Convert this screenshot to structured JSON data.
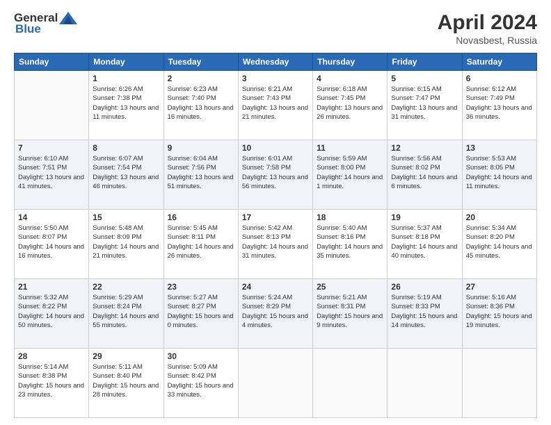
{
  "logo": {
    "general": "General",
    "blue": "Blue"
  },
  "title": "April 2024",
  "location": "Novasbest, Russia",
  "days_header": [
    "Sunday",
    "Monday",
    "Tuesday",
    "Wednesday",
    "Thursday",
    "Friday",
    "Saturday"
  ],
  "weeks": [
    [
      {
        "day": "",
        "sunrise": "",
        "sunset": "",
        "daylight": ""
      },
      {
        "day": "1",
        "sunrise": "Sunrise: 6:26 AM",
        "sunset": "Sunset: 7:38 PM",
        "daylight": "Daylight: 13 hours and 11 minutes."
      },
      {
        "day": "2",
        "sunrise": "Sunrise: 6:23 AM",
        "sunset": "Sunset: 7:40 PM",
        "daylight": "Daylight: 13 hours and 16 minutes."
      },
      {
        "day": "3",
        "sunrise": "Sunrise: 6:21 AM",
        "sunset": "Sunset: 7:43 PM",
        "daylight": "Daylight: 13 hours and 21 minutes."
      },
      {
        "day": "4",
        "sunrise": "Sunrise: 6:18 AM",
        "sunset": "Sunset: 7:45 PM",
        "daylight": "Daylight: 13 hours and 26 minutes."
      },
      {
        "day": "5",
        "sunrise": "Sunrise: 6:15 AM",
        "sunset": "Sunset: 7:47 PM",
        "daylight": "Daylight: 13 hours and 31 minutes."
      },
      {
        "day": "6",
        "sunrise": "Sunrise: 6:12 AM",
        "sunset": "Sunset: 7:49 PM",
        "daylight": "Daylight: 13 hours and 36 minutes."
      }
    ],
    [
      {
        "day": "7",
        "sunrise": "Sunrise: 6:10 AM",
        "sunset": "Sunset: 7:51 PM",
        "daylight": "Daylight: 13 hours and 41 minutes."
      },
      {
        "day": "8",
        "sunrise": "Sunrise: 6:07 AM",
        "sunset": "Sunset: 7:54 PM",
        "daylight": "Daylight: 13 hours and 46 minutes."
      },
      {
        "day": "9",
        "sunrise": "Sunrise: 6:04 AM",
        "sunset": "Sunset: 7:56 PM",
        "daylight": "Daylight: 13 hours and 51 minutes."
      },
      {
        "day": "10",
        "sunrise": "Sunrise: 6:01 AM",
        "sunset": "Sunset: 7:58 PM",
        "daylight": "Daylight: 13 hours and 56 minutes."
      },
      {
        "day": "11",
        "sunrise": "Sunrise: 5:59 AM",
        "sunset": "Sunset: 8:00 PM",
        "daylight": "Daylight: 14 hours and 1 minute."
      },
      {
        "day": "12",
        "sunrise": "Sunrise: 5:56 AM",
        "sunset": "Sunset: 8:02 PM",
        "daylight": "Daylight: 14 hours and 6 minutes."
      },
      {
        "day": "13",
        "sunrise": "Sunrise: 5:53 AM",
        "sunset": "Sunset: 8:05 PM",
        "daylight": "Daylight: 14 hours and 11 minutes."
      }
    ],
    [
      {
        "day": "14",
        "sunrise": "Sunrise: 5:50 AM",
        "sunset": "Sunset: 8:07 PM",
        "daylight": "Daylight: 14 hours and 16 minutes."
      },
      {
        "day": "15",
        "sunrise": "Sunrise: 5:48 AM",
        "sunset": "Sunset: 8:09 PM",
        "daylight": "Daylight: 14 hours and 21 minutes."
      },
      {
        "day": "16",
        "sunrise": "Sunrise: 5:45 AM",
        "sunset": "Sunset: 8:11 PM",
        "daylight": "Daylight: 14 hours and 26 minutes."
      },
      {
        "day": "17",
        "sunrise": "Sunrise: 5:42 AM",
        "sunset": "Sunset: 8:13 PM",
        "daylight": "Daylight: 14 hours and 31 minutes."
      },
      {
        "day": "18",
        "sunrise": "Sunrise: 5:40 AM",
        "sunset": "Sunset: 8:16 PM",
        "daylight": "Daylight: 14 hours and 35 minutes."
      },
      {
        "day": "19",
        "sunrise": "Sunrise: 5:37 AM",
        "sunset": "Sunset: 8:18 PM",
        "daylight": "Daylight: 14 hours and 40 minutes."
      },
      {
        "day": "20",
        "sunrise": "Sunrise: 5:34 AM",
        "sunset": "Sunset: 8:20 PM",
        "daylight": "Daylight: 14 hours and 45 minutes."
      }
    ],
    [
      {
        "day": "21",
        "sunrise": "Sunrise: 5:32 AM",
        "sunset": "Sunset: 8:22 PM",
        "daylight": "Daylight: 14 hours and 50 minutes."
      },
      {
        "day": "22",
        "sunrise": "Sunrise: 5:29 AM",
        "sunset": "Sunset: 8:24 PM",
        "daylight": "Daylight: 14 hours and 55 minutes."
      },
      {
        "day": "23",
        "sunrise": "Sunrise: 5:27 AM",
        "sunset": "Sunset: 8:27 PM",
        "daylight": "Daylight: 15 hours and 0 minutes."
      },
      {
        "day": "24",
        "sunrise": "Sunrise: 5:24 AM",
        "sunset": "Sunset: 8:29 PM",
        "daylight": "Daylight: 15 hours and 4 minutes."
      },
      {
        "day": "25",
        "sunrise": "Sunrise: 5:21 AM",
        "sunset": "Sunset: 8:31 PM",
        "daylight": "Daylight: 15 hours and 9 minutes."
      },
      {
        "day": "26",
        "sunrise": "Sunrise: 5:19 AM",
        "sunset": "Sunset: 8:33 PM",
        "daylight": "Daylight: 15 hours and 14 minutes."
      },
      {
        "day": "27",
        "sunrise": "Sunrise: 5:16 AM",
        "sunset": "Sunset: 8:36 PM",
        "daylight": "Daylight: 15 hours and 19 minutes."
      }
    ],
    [
      {
        "day": "28",
        "sunrise": "Sunrise: 5:14 AM",
        "sunset": "Sunset: 8:38 PM",
        "daylight": "Daylight: 15 hours and 23 minutes."
      },
      {
        "day": "29",
        "sunrise": "Sunrise: 5:11 AM",
        "sunset": "Sunset: 8:40 PM",
        "daylight": "Daylight: 15 hours and 28 minutes."
      },
      {
        "day": "30",
        "sunrise": "Sunrise: 5:09 AM",
        "sunset": "Sunset: 8:42 PM",
        "daylight": "Daylight: 15 hours and 33 minutes."
      },
      {
        "day": "",
        "sunrise": "",
        "sunset": "",
        "daylight": ""
      },
      {
        "day": "",
        "sunrise": "",
        "sunset": "",
        "daylight": ""
      },
      {
        "day": "",
        "sunrise": "",
        "sunset": "",
        "daylight": ""
      },
      {
        "day": "",
        "sunrise": "",
        "sunset": "",
        "daylight": ""
      }
    ]
  ]
}
